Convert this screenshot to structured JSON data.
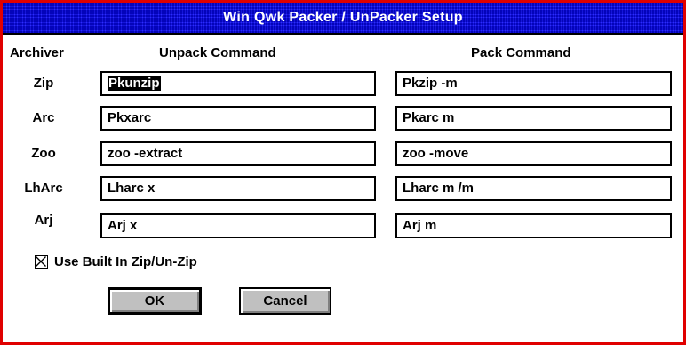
{
  "window": {
    "title": "Win Qwk Packer / UnPacker Setup"
  },
  "headers": {
    "archiver": "Archiver",
    "unpack": "Unpack Command",
    "pack": "Pack Command"
  },
  "rows": [
    {
      "label": "Zip",
      "unpack": "Pkunzip",
      "pack": "Pkzip -m"
    },
    {
      "label": "Arc",
      "unpack": "Pkxarc",
      "pack": "Pkarc m"
    },
    {
      "label": "Zoo",
      "unpack": "zoo -extract",
      "pack": "zoo -move"
    },
    {
      "label": "LhArc",
      "unpack": "Lharc x",
      "pack": "Lharc m /m"
    },
    {
      "label": "Arj",
      "unpack": "Arj x",
      "pack": "Arj m"
    }
  ],
  "option": {
    "label": "Use Built In Zip/Un-Zip",
    "checked": true
  },
  "buttons": {
    "ok": "OK",
    "cancel": "Cancel"
  }
}
